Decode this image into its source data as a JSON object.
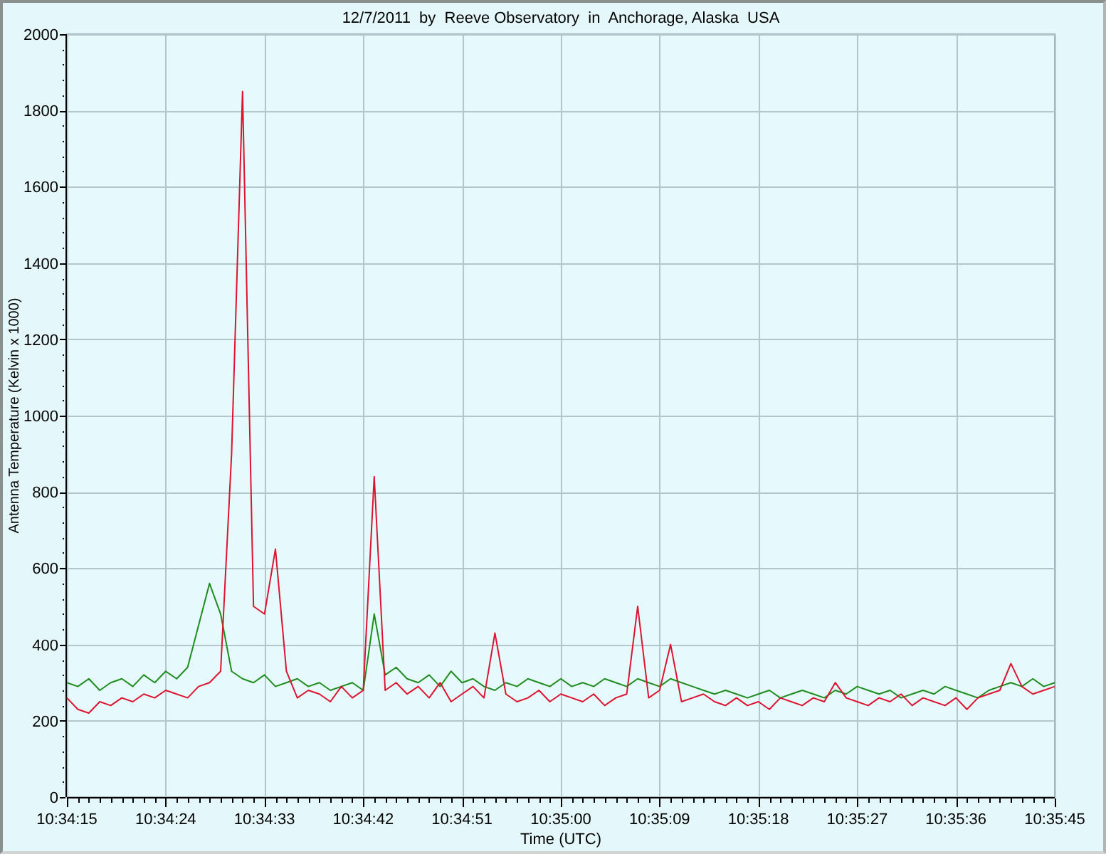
{
  "chart": {
    "chart_data": {
      "type": "line",
      "title": "12/7/2011  by  Reeve Observatory  in  Anchorage, Alaska  USA",
      "xlabel": "Time (UTC)",
      "ylabel": "Antenna Temperature (Kelvin x 1000)",
      "categories": [
        "10:34:15",
        null,
        null,
        null,
        null,
        null,
        null,
        null,
        null,
        "10:34:24",
        null,
        null,
        null,
        null,
        null,
        null,
        null,
        null,
        "10:34:33",
        null,
        null,
        null,
        null,
        null,
        null,
        null,
        null,
        "10:34:42",
        null,
        null,
        null,
        null,
        null,
        null,
        null,
        null,
        "10:34:51",
        null,
        null,
        null,
        null,
        null,
        null,
        null,
        null,
        "10:35:00",
        null,
        null,
        null,
        null,
        null,
        null,
        null,
        null,
        "10:35:09",
        null,
        null,
        null,
        null,
        null,
        null,
        null,
        null,
        "10:35:18",
        null,
        null,
        null,
        null,
        null,
        null,
        null,
        null,
        "10:35:27",
        null,
        null,
        null,
        null,
        null,
        null,
        null,
        null,
        "10:35:36",
        null,
        null,
        null,
        null,
        null,
        null,
        null,
        null,
        "10:35:45"
      ],
      "series": [
        {
          "color": "#1e8c1e",
          "values": [
            300,
            290,
            310,
            280,
            300,
            310,
            290,
            320,
            300,
            330,
            310,
            340,
            450,
            560,
            480,
            330,
            310,
            300,
            320,
            290,
            300,
            310,
            290,
            300,
            280,
            290,
            300,
            280,
            480,
            320,
            340,
            310,
            300,
            320,
            290,
            330,
            300,
            310,
            290,
            280,
            300,
            290,
            310,
            300,
            290,
            310,
            290,
            300,
            290,
            310,
            300,
            290,
            310,
            300,
            290,
            310,
            300,
            290,
            280,
            270,
            280,
            270,
            260,
            270,
            280,
            260,
            270,
            280,
            270,
            260,
            280,
            270,
            290,
            280,
            270,
            280,
            260,
            270,
            280,
            270,
            290,
            280,
            270,
            260,
            280,
            290,
            300,
            290,
            310,
            290,
            300
          ]
        },
        {
          "color": "#dc1430",
          "values": [
            260,
            230,
            220,
            250,
            240,
            260,
            250,
            270,
            260,
            280,
            270,
            260,
            290,
            300,
            330,
            900,
            1850,
            500,
            480,
            650,
            330,
            260,
            280,
            270,
            250,
            290,
            260,
            280,
            840,
            280,
            300,
            270,
            290,
            260,
            300,
            250,
            270,
            290,
            260,
            430,
            270,
            250,
            260,
            280,
            250,
            270,
            260,
            250,
            270,
            240,
            260,
            270,
            500,
            260,
            280,
            400,
            250,
            260,
            270,
            250,
            240,
            260,
            240,
            250,
            230,
            260,
            250,
            240,
            260,
            250,
            300,
            260,
            250,
            240,
            260,
            250,
            270,
            240,
            260,
            250,
            240,
            260,
            230,
            260,
            270,
            280,
            350,
            290,
            270,
            280,
            290
          ]
        }
      ],
      "ylim": [
        0,
        2000
      ],
      "grid": true,
      "yticks": [
        0,
        200,
        400,
        600,
        800,
        1000,
        1200,
        1400,
        1600,
        1800,
        2000
      ]
    }
  }
}
